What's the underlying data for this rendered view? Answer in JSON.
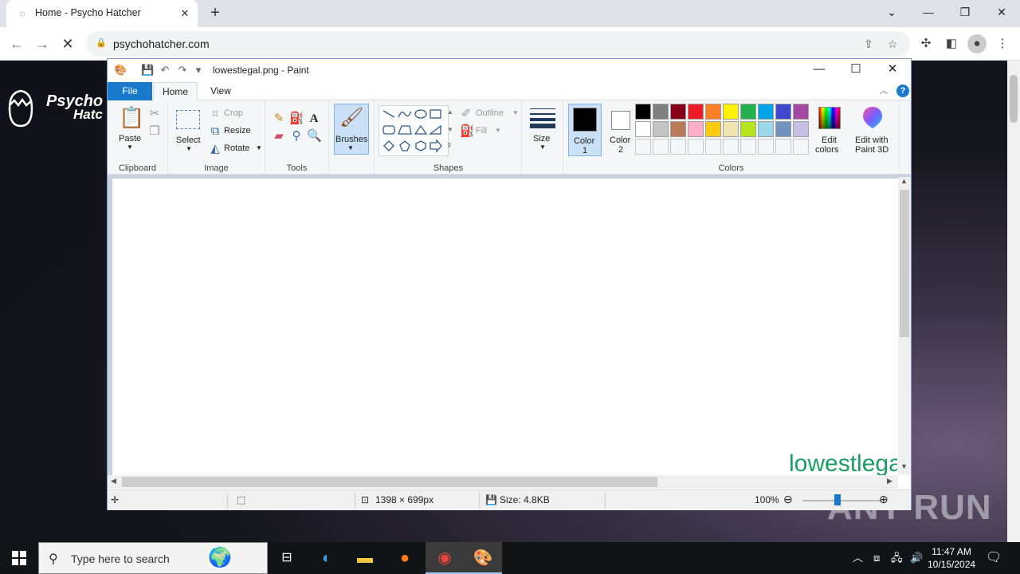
{
  "browser": {
    "tab_title": "Home - Psycho Hatcher",
    "new_tab": "+",
    "url": "psychohatcher.com",
    "window_controls": {
      "chevron": "⌄",
      "minimize": "—",
      "restore": "❐",
      "close": "✕"
    }
  },
  "site": {
    "logo_line1": "Psycho",
    "logo_line2": "Hatc",
    "watermark": "ANY RUN"
  },
  "paint": {
    "title": "lowestlegal.png - Paint",
    "tabs": {
      "file": "File",
      "home": "Home",
      "view": "View"
    },
    "clipboard": {
      "paste": "Paste",
      "label": "Clipboard"
    },
    "image": {
      "select": "Select",
      "crop": "Crop",
      "resize": "Resize",
      "rotate": "Rotate",
      "label": "Image"
    },
    "tools": {
      "label": "Tools",
      "text_icon": "A"
    },
    "brushes": "Brushes",
    "shapes": {
      "outline": "Outline",
      "fill": "Fill",
      "label": "Shapes"
    },
    "size": "Size",
    "color1": {
      "line1": "Color",
      "line2": "1",
      "value": "#000000"
    },
    "color2": {
      "line1": "Color",
      "line2": "2",
      "value": "#ffffff"
    },
    "palette_row1": [
      "#000000",
      "#7f7f7f",
      "#880015",
      "#ed1c24",
      "#ff7f27",
      "#fff200",
      "#22b14c",
      "#00a2e8",
      "#3f48cc",
      "#a349a4"
    ],
    "palette_row2": [
      "#ffffff",
      "#c3c3c3",
      "#b97a57",
      "#ffaec9",
      "#ffc90e",
      "#efe4b0",
      "#b5e61d",
      "#99d9ea",
      "#7092be",
      "#c8bfe7"
    ],
    "colors_label": "Colors",
    "edit_colors": {
      "line1": "Edit",
      "line2": "colors"
    },
    "edit_paint3d": {
      "line1": "Edit with",
      "line2": "Paint 3D"
    },
    "canvas_text": "lowestlegal",
    "canvas_text_color": "#1a9e62",
    "status": {
      "dimensions": "1398 × 699px",
      "size": "Size: 4.8KB",
      "zoom": "100%"
    }
  },
  "taskbar": {
    "search_placeholder": "Type here to search",
    "time": "11:47 AM",
    "date": "10/15/2024"
  }
}
